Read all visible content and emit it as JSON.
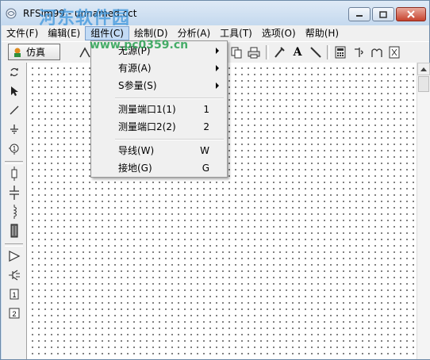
{
  "window": {
    "title": "RFSim99 - unnamed.cct",
    "watermark": "河东软件园",
    "watermark_url": "www.pc0359.cn"
  },
  "menubar": {
    "items": [
      {
        "label": "文件(F)"
      },
      {
        "label": "编辑(E)"
      },
      {
        "label": "组件(C)"
      },
      {
        "label": "绘制(D)"
      },
      {
        "label": "分析(A)"
      },
      {
        "label": "工具(T)"
      },
      {
        "label": "选项(O)"
      },
      {
        "label": "帮助(H)"
      }
    ],
    "active_index": 2
  },
  "toolbar": {
    "simulate_label": "仿真",
    "text_tool_glyph": "A"
  },
  "palette": {
    "port1_label": "1",
    "port2_label": "2"
  },
  "component_menu": {
    "items": [
      {
        "label": "无源(P)",
        "submenu": true
      },
      {
        "label": "有源(A)",
        "submenu": true
      },
      {
        "label": "S参量(S)",
        "submenu": true
      },
      {
        "label": "测量端口1(1)",
        "shortcut": "1"
      },
      {
        "label": "测量端口2(2)",
        "shortcut": "2"
      },
      {
        "label": "导线(W)",
        "shortcut": "W"
      },
      {
        "label": "接地(G)",
        "shortcut": "G"
      }
    ]
  },
  "colors": {
    "title_bar": "#c9ddef",
    "close_button": "#c7432e",
    "menu_highlight": "#c3dbf5"
  }
}
